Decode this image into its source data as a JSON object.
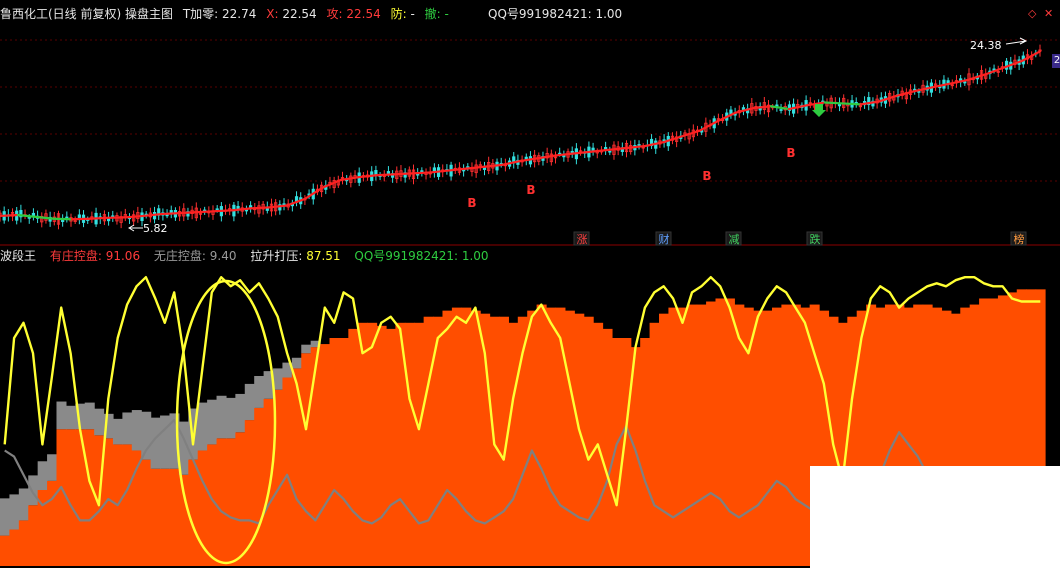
{
  "header": {
    "title": "鲁西化工(日线 前复权) 操盘主图",
    "t_label": "T加零:",
    "t_value": "22.74",
    "x_label": "X:",
    "x_value": "22.54",
    "atk_label": "攻:",
    "atk_value": "22.54",
    "def_label": "防:",
    "def_value": "-",
    "rev_label": "撤:",
    "rev_value": "-",
    "qq": "QQ号991982421: 1.00",
    "ctrl_up": "◇",
    "ctrl_x": "✕",
    "right_badge": "2"
  },
  "indicator_header": {
    "name": "波段王",
    "m1_label": "有庄控盘:",
    "m1_value": "91.06",
    "m2_label": "无庄控盘:",
    "m2_value": "9.40",
    "m3_label": "拉升打压:",
    "m3_value": "87.51",
    "qq": "QQ号991982421: 1.00"
  },
  "annotations": {
    "high": "24.38",
    "low": "5.82"
  },
  "events": [
    {
      "label": "涨",
      "color": "#ff4040"
    },
    {
      "label": "财",
      "color": "#60a0ff"
    },
    {
      "label": "减",
      "color": "#40d060"
    },
    {
      "label": "跌",
      "color": "#40d060"
    },
    {
      "label": "榜",
      "color": "#ff9a40"
    }
  ],
  "signals": [
    "B",
    "B",
    "B",
    "B"
  ],
  "colors": {
    "background": "#000000",
    "grid": "#5a0000",
    "ma_up": "#ff2020",
    "ma_neutral": "#2ecc40",
    "control_area": "#ff4e00",
    "no_control_area": "#8a8a8a",
    "price_line": "#ffff33",
    "gray_line": "#808080",
    "highlight_circle": "#ffff33"
  },
  "chart_data": {
    "type": "area",
    "series": [
      {
        "name": "有庄控盘",
        "values": [
          10,
          12,
          15,
          20,
          25,
          28,
          45,
          45,
          45,
          45,
          43,
          42,
          40,
          40,
          38,
          35,
          32,
          32,
          32,
          30,
          35,
          38,
          40,
          42,
          42,
          44,
          48,
          52,
          55,
          58,
          62,
          65,
          70,
          72,
          73,
          75,
          75,
          78,
          80,
          80,
          79,
          78,
          80,
          80,
          80,
          82,
          82,
          84,
          85,
          85,
          84,
          83,
          82,
          82,
          80,
          82,
          84,
          86,
          85,
          85,
          84,
          83,
          82,
          80,
          78,
          75,
          75,
          72,
          75,
          80,
          83,
          85,
          85,
          86,
          86,
          87,
          88,
          88,
          86,
          85,
          84,
          84,
          85,
          86,
          86,
          85,
          86,
          84,
          82,
          80,
          82,
          84,
          86,
          85,
          86,
          86,
          85,
          86,
          86,
          85,
          84,
          83,
          85,
          86,
          88,
          88,
          89,
          90,
          91,
          91,
          91
        ]
      },
      {
        "name": "无庄控盘",
        "values": [
          35,
          33,
          30,
          28,
          27,
          25,
          26,
          22,
          24,
          25,
          25,
          23,
          24,
          30,
          38,
          45,
          48,
          50,
          52,
          50,
          48,
          45,
          42,
          40,
          38,
          36,
          34,
          30,
          26,
          20,
          14,
          10,
          8,
          6,
          5,
          4,
          3,
          3,
          2,
          2,
          2,
          2,
          2,
          2,
          2,
          2,
          2,
          2,
          2,
          2,
          2,
          2,
          2,
          2,
          2,
          2,
          2,
          2,
          2,
          2,
          2,
          2,
          2,
          2,
          2,
          2,
          2,
          2,
          2,
          2,
          2,
          2,
          2,
          2,
          2,
          2,
          2,
          2,
          2,
          2,
          2,
          2,
          2,
          2,
          2,
          2,
          2,
          2,
          2,
          2,
          2,
          2,
          2,
          2,
          2,
          2,
          2,
          2,
          2,
          2,
          2,
          2,
          2,
          2,
          2,
          2,
          2,
          2,
          2,
          2,
          2
        ]
      },
      {
        "name": "拉升打压",
        "values": [
          40,
          75,
          80,
          70,
          40,
          62,
          85,
          70,
          45,
          28,
          20,
          55,
          75,
          86,
          92,
          95,
          88,
          80,
          90,
          70,
          40,
          65,
          90,
          95,
          92,
          94,
          90,
          93,
          88,
          82,
          70,
          60,
          45,
          65,
          85,
          80,
          90,
          88,
          70,
          72,
          80,
          82,
          78,
          55,
          45,
          60,
          75,
          78,
          82,
          80,
          85,
          70,
          40,
          35,
          55,
          70,
          82,
          86,
          80,
          75,
          60,
          45,
          35,
          40,
          30,
          20,
          45,
          72,
          85,
          90,
          92,
          88,
          80,
          90,
          92,
          95,
          92,
          85,
          75,
          70,
          82,
          88,
          92,
          90,
          85,
          80,
          70,
          60,
          40,
          28,
          55,
          75,
          88,
          92,
          90,
          85,
          88,
          90,
          92,
          93,
          92,
          94,
          95,
          95,
          93,
          92,
          92,
          88,
          87,
          87,
          87
        ]
      },
      {
        "name": "QQ号991982421",
        "values": [
          38,
          36,
          30,
          24,
          20,
          22,
          26,
          20,
          15,
          15,
          18,
          22,
          20,
          25,
          32,
          38,
          42,
          45,
          48,
          42,
          35,
          28,
          22,
          18,
          16,
          15,
          15,
          14,
          20,
          25,
          30,
          22,
          18,
          15,
          20,
          25,
          22,
          18,
          15,
          14,
          16,
          20,
          22,
          18,
          14,
          15,
          20,
          25,
          22,
          18,
          15,
          14,
          16,
          18,
          22,
          30,
          38,
          32,
          25,
          20,
          18,
          16,
          15,
          20,
          28,
          40,
          46,
          38,
          28,
          20,
          18,
          16,
          18,
          20,
          22,
          24,
          22,
          18,
          16,
          18,
          20,
          24,
          28,
          26,
          22,
          20,
          18,
          16,
          18,
          20,
          22,
          24,
          26,
          30,
          38,
          44,
          40,
          36,
          30,
          28,
          26,
          24,
          22,
          20,
          22,
          24,
          26,
          24,
          22,
          20,
          20
        ]
      }
    ],
    "ylim": [
      0,
      100
    ]
  },
  "price_chart": {
    "type": "line",
    "name": "MA",
    "values": [
      6.2,
      6.3,
      6.1,
      5.9,
      5.85,
      5.9,
      6.0,
      6.05,
      6.2,
      6.4,
      6.5,
      6.6,
      6.7,
      6.8,
      7.0,
      7.1,
      7.3,
      8.0,
      9.2,
      10.0,
      10.3,
      10.5,
      10.6,
      10.7,
      10.8,
      11.0,
      11.2,
      11.4,
      11.6,
      12.0,
      12.3,
      12.6,
      12.8,
      13.0,
      13.2,
      13.4,
      13.6,
      14.0,
      14.6,
      15.2,
      16.2,
      17.1,
      17.6,
      17.8,
      17.5,
      17.9,
      18.2,
      18.1,
      18.0,
      18.3,
      18.9,
      19.4,
      19.8,
      20.2,
      20.6,
      21.2,
      21.9,
      22.6,
      23.6
    ],
    "ylim": [
      4.5,
      26.5
    ]
  }
}
